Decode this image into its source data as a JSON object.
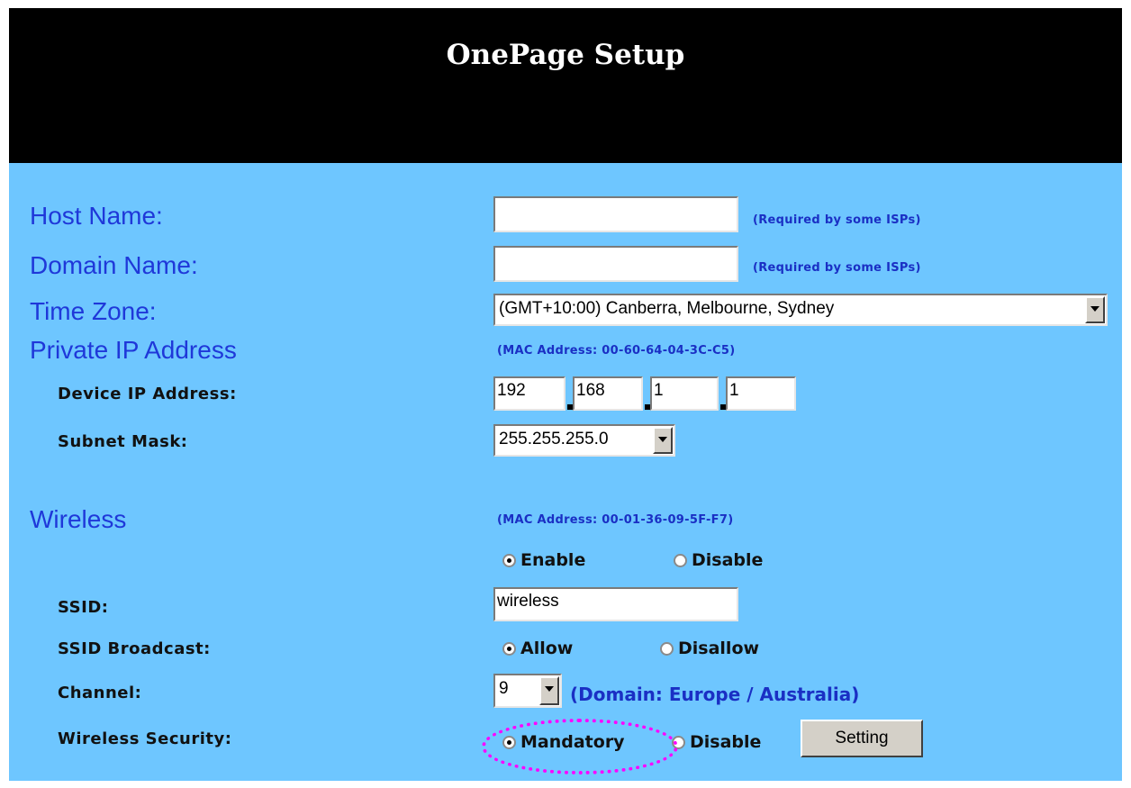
{
  "header": {
    "title": "OnePage Setup"
  },
  "host_name": {
    "label": "Host Name:",
    "value": "",
    "note": "(Required by some ISPs)"
  },
  "domain_name": {
    "label": "Domain Name:",
    "value": "",
    "note": "(Required by some ISPs)"
  },
  "time_zone": {
    "label": "Time Zone:",
    "selected": "(GMT+10:00) Canberra, Melbourne, Sydney"
  },
  "private_ip": {
    "label": "Private IP Address",
    "mac": "(MAC Address: 00-60-64-04-3C-C5)",
    "device_ip_label": "Device IP Address:",
    "octets": [
      "192",
      "168",
      "1",
      "1"
    ],
    "subnet_label": "Subnet Mask:",
    "subnet_selected": "255.255.255.0"
  },
  "wireless": {
    "label": "Wireless",
    "mac": "(MAC Address: 00-01-36-09-5F-F7)",
    "enable_label": "Enable",
    "disable_label": "Disable",
    "enabled": true,
    "ssid_label": "SSID:",
    "ssid_value": "wireless",
    "broadcast_label": "SSID Broadcast:",
    "allow_label": "Allow",
    "disallow_label": "Disallow",
    "broadcast_allowed": true,
    "channel_label": "Channel:",
    "channel_selected": "9",
    "domain_note": "(Domain: Europe / Australia)",
    "security_label": "Wireless Security:",
    "mandatory_label": "Mandatory",
    "security_disable_label": "Disable",
    "security_mandatory": true,
    "setting_button": "Setting"
  },
  "colors": {
    "background": "#6ec6ff",
    "header": "#000000",
    "label_blue": "#1f38d9",
    "highlight": "#ff00ff"
  }
}
